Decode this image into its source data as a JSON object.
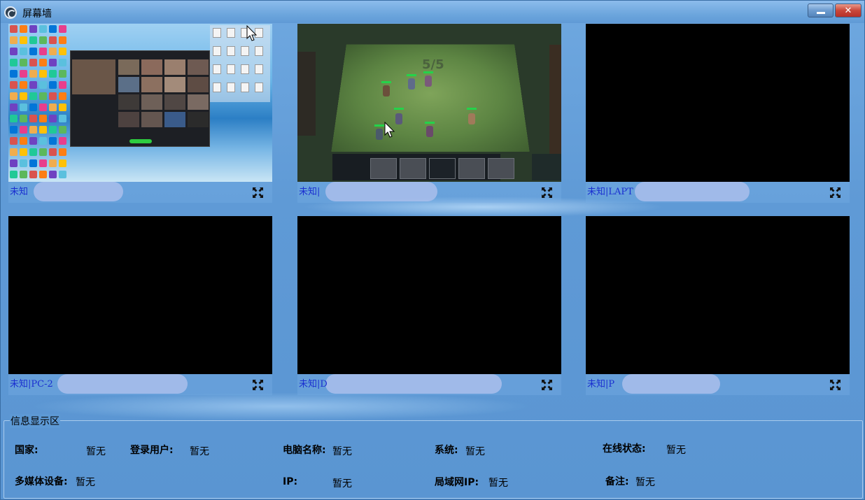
{
  "window": {
    "title": "屏幕墙",
    "minimize_label": "—",
    "close_label": "✕"
  },
  "tiles": [
    {
      "label": "未知",
      "screen": "desktop"
    },
    {
      "label": "未知|",
      "screen": "game"
    },
    {
      "label": "未知|LAPT",
      "screen": "black"
    },
    {
      "label": "未知|PC-2",
      "screen": "black"
    },
    {
      "label": "未知|D",
      "screen": "black"
    },
    {
      "label": "未知|P",
      "screen": "black"
    }
  ],
  "game_overlay": {
    "round": "5/5"
  },
  "info": {
    "legend": "信息显示区",
    "country_label": "国家:",
    "country_value": "暂无",
    "login_user_label": "登录用户:",
    "login_user_value": "暂无",
    "computer_name_label": "电脑名称:",
    "computer_name_value": "暂无",
    "system_label": "系统:",
    "system_value": "暂无",
    "online_label": "在线状态:",
    "online_value": "暂无",
    "media_label": "多媒体设备:",
    "media_value": "暂无",
    "ip_label": "IP:",
    "ip_value": "暂无",
    "lan_ip_label": "局域网IP:",
    "lan_ip_value": "暂无",
    "remark_label": "备注:",
    "remark_value": "暂无"
  },
  "icons": {
    "app": "screen-wall-app-icon",
    "minimize": "minimize-icon",
    "close": "close-icon",
    "expand": "fullscreen-expand-icon"
  }
}
